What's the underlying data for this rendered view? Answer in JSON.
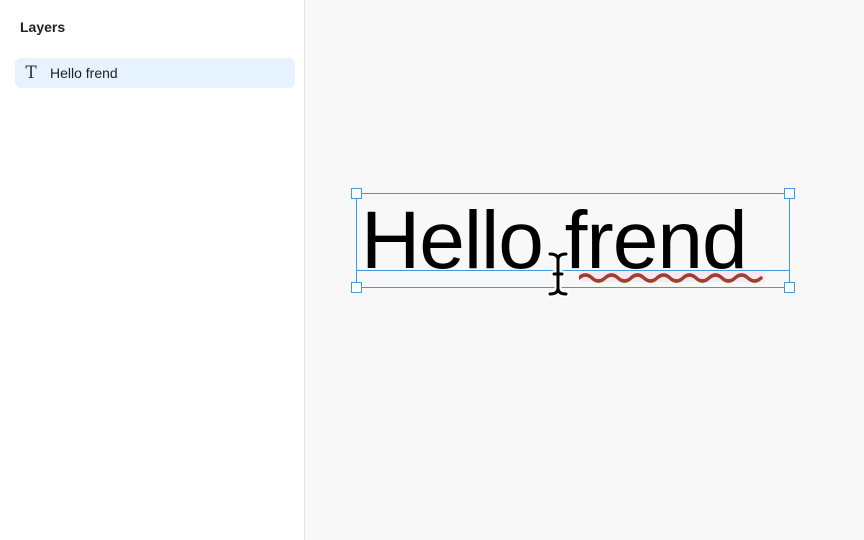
{
  "layers_panel": {
    "title": "Layers",
    "items": [
      {
        "label": "Hello frend",
        "icon": "text-layer-icon",
        "glyph": "T",
        "selected": true
      }
    ]
  },
  "canvas": {
    "text_layer": {
      "content": "Hello frend",
      "misspelled_word": "frend"
    }
  },
  "colors": {
    "selection": "#3b9be8",
    "layer_selected_bg": "#e6f2fd",
    "canvas_bg": "#f8f8f9",
    "spellcheck_squiggle": "#a0402c"
  }
}
